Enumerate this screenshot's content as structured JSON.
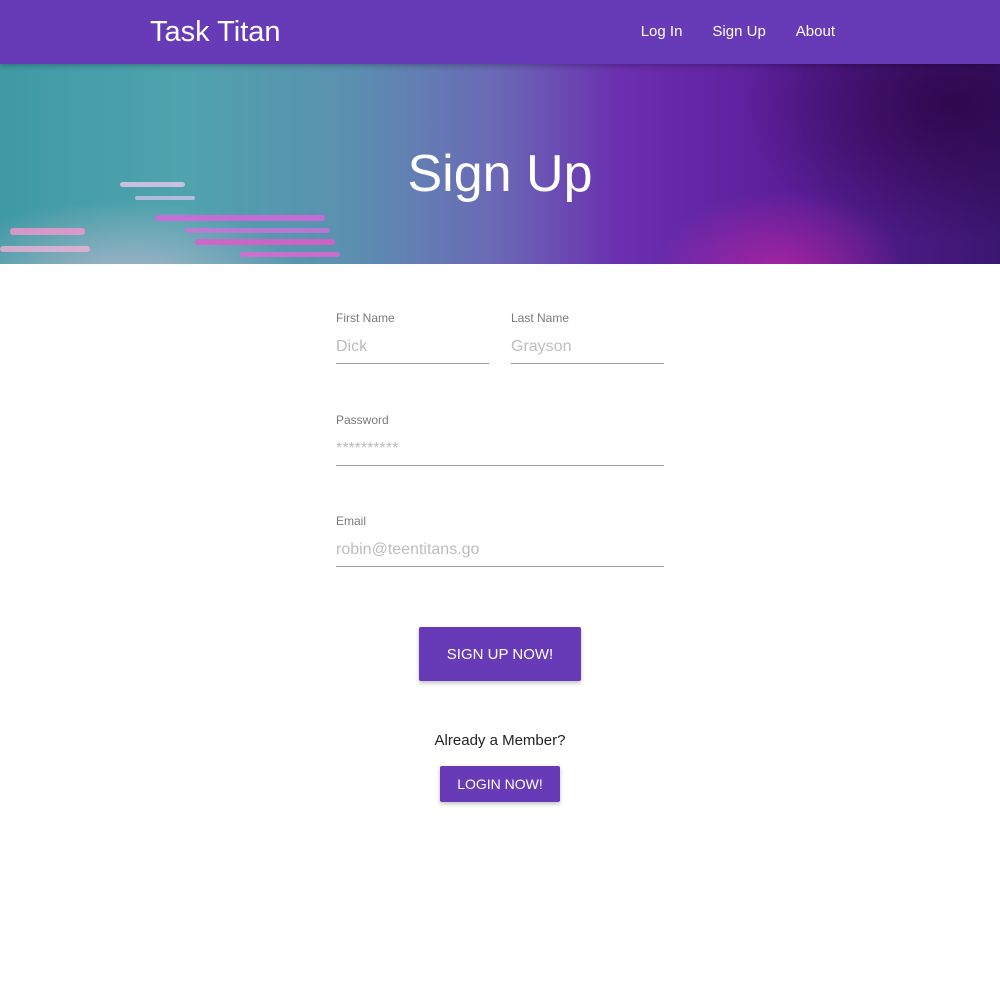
{
  "app": {
    "brand": "Task Titan",
    "accent_color": "#673ab7"
  },
  "nav": {
    "items": [
      {
        "label": "Log In"
      },
      {
        "label": "Sign Up"
      },
      {
        "label": "About"
      }
    ]
  },
  "hero": {
    "title": "Sign Up"
  },
  "form": {
    "first_name": {
      "label": "First Name",
      "placeholder": "Dick",
      "value": ""
    },
    "last_name": {
      "label": "Last Name",
      "placeholder": "Grayson",
      "value": ""
    },
    "password": {
      "label": "Password",
      "placeholder": "**********",
      "value": ""
    },
    "email": {
      "label": "Email",
      "placeholder": "robin@teentitans.go",
      "value": ""
    },
    "submit_label": "Sign Up Now!"
  },
  "login": {
    "prompt": "Already a Member?",
    "button_label": "Login Now!"
  }
}
